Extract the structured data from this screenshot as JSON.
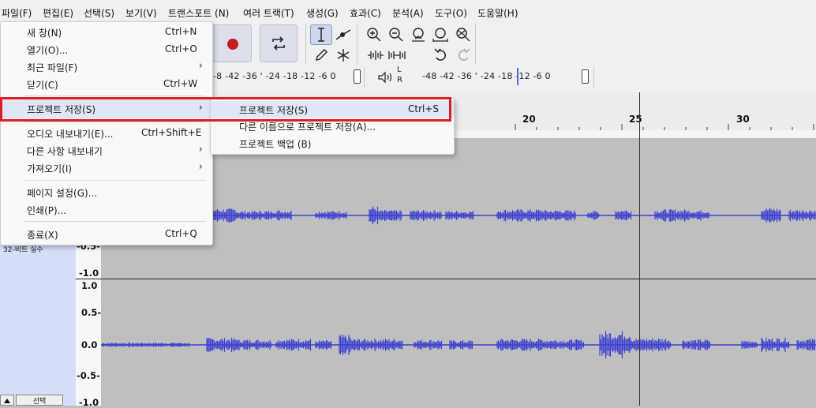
{
  "menubar": {
    "items": [
      "파일(F)",
      "편집(E)",
      "선택(S)",
      "보기(V)",
      "트랜스포트 (N)",
      "여러 트랙(T)",
      "생성(G)",
      "효과(C)",
      "분석(A)",
      "도구(O)",
      "도움말(H)"
    ]
  },
  "meters": {
    "record_scale": "-8 -42 -36  '  -24 -18 -12  -6  0",
    "play_scale": "-48 -42 -36  '  -24 -18 -12  -6  0",
    "lr_top": "L",
    "lr_bottom": "R"
  },
  "timeline": {
    "ticks": [
      "20",
      "25",
      "30"
    ]
  },
  "track": {
    "sample_format": "32-비트 실수",
    "select_label": "선택",
    "scale_upper": [
      "-0.5-",
      "-1.0"
    ],
    "scale_lower": [
      "1.0",
      "0.5-",
      "0.0",
      "-0.5-",
      "-1.0"
    ]
  },
  "file_menu": {
    "items": [
      {
        "label": "새 창(N)",
        "shortcut": "Ctrl+N",
        "submenu": false
      },
      {
        "label": "열기(O)...",
        "shortcut": "Ctrl+O",
        "submenu": false
      },
      {
        "label": "최근 파일(F)",
        "shortcut": "",
        "submenu": true
      },
      {
        "label": "닫기(C)",
        "shortcut": "Ctrl+W",
        "submenu": false
      },
      {
        "label": "프로젝트 저장(S)",
        "shortcut": "",
        "submenu": true
      },
      {
        "label": "오디오 내보내기(E)...",
        "shortcut": "Ctrl+Shift+E",
        "submenu": false
      },
      {
        "label": "다른 사항 내보내기",
        "shortcut": "",
        "submenu": true
      },
      {
        "label": "가져오기(I)",
        "shortcut": "",
        "submenu": true
      },
      {
        "label": "페이지 설정(G)...",
        "shortcut": "",
        "submenu": false
      },
      {
        "label": "인쇄(P)...",
        "shortcut": "",
        "submenu": false
      },
      {
        "label": "종료(X)",
        "shortcut": "Ctrl+Q",
        "submenu": false
      }
    ]
  },
  "save_submenu": {
    "items": [
      {
        "label": "프로젝트 저장(S)",
        "shortcut": "Ctrl+S"
      },
      {
        "label": "다른 이름으로 프로젝트 저장(A)...",
        "shortcut": ""
      },
      {
        "label": "프로젝트 백업 (B)",
        "shortcut": ""
      }
    ]
  },
  "colors": {
    "highlight": "#e21b25",
    "waveform": "#3b3fd1",
    "record": "#c41e1e",
    "track_panel": "#d4def9"
  }
}
